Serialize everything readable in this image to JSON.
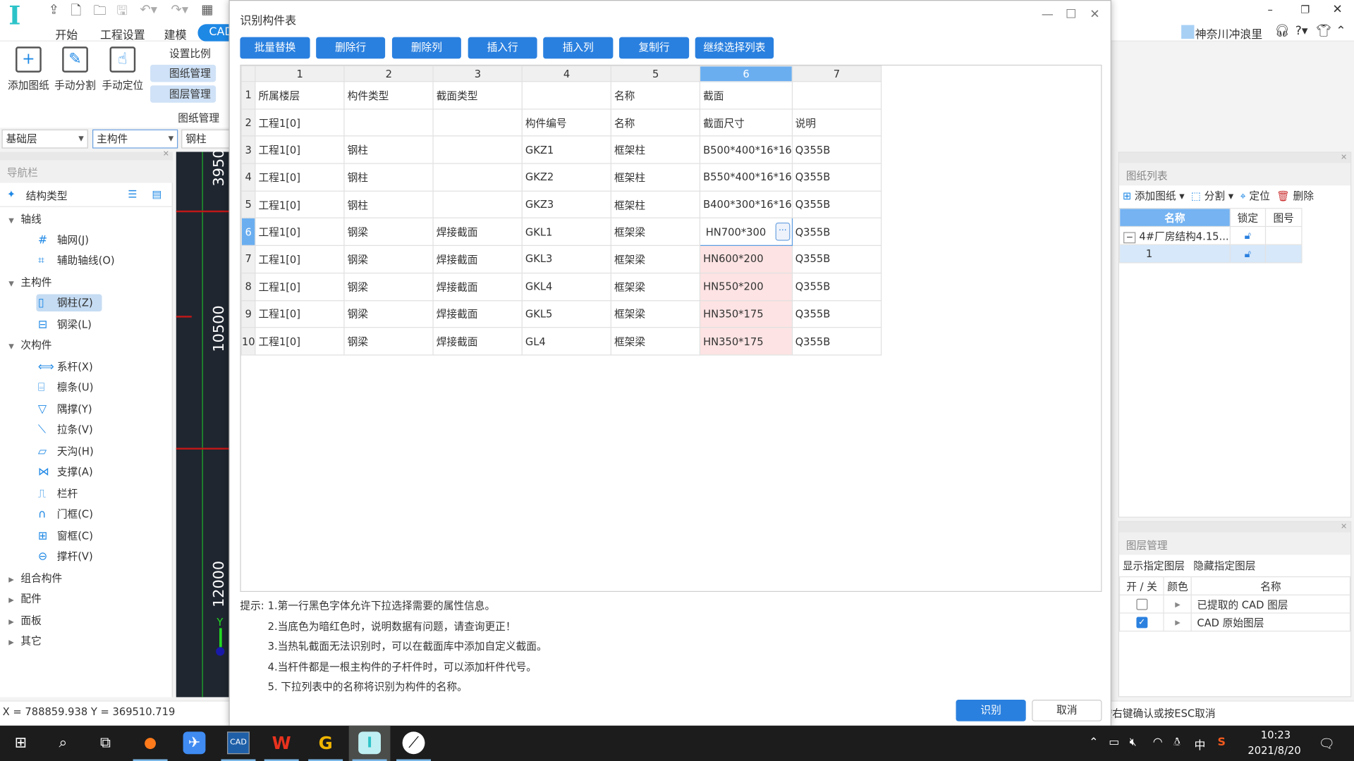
{
  "app": {
    "menu": [
      "开始",
      "工程设置",
      "建模",
      "CAD"
    ],
    "user": "神奈川冲浪里",
    "ribbon": {
      "big_buttons": [
        "添加图纸",
        "手动分割",
        "手动定位"
      ],
      "small_buttons": [
        "设置比例",
        "图纸管理",
        "图层管理"
      ],
      "group_label": "图纸管理"
    },
    "selectors": {
      "floor": "基础层",
      "category": "主构件",
      "type": "钢柱"
    }
  },
  "nav": {
    "title": "导航栏",
    "subtitle": "结构类型",
    "groups": [
      {
        "label": "轴线",
        "expanded": true,
        "items": [
          "轴网(J)",
          "辅助轴线(O)"
        ]
      },
      {
        "label": "主构件",
        "expanded": true,
        "items": [
          "钢柱(Z)",
          "钢梁(L)"
        ],
        "selected": "钢柱(Z)"
      },
      {
        "label": "次构件",
        "expanded": true,
        "items": [
          "系杆(X)",
          "檩条(U)",
          "隅撑(Y)",
          "拉条(V)",
          "天沟(H)",
          "支撑(A)",
          "栏杆",
          "门框(C)",
          "窗框(C)",
          "撑杆(V)"
        ]
      },
      {
        "label": "组合构件",
        "expanded": false
      },
      {
        "label": "配件",
        "expanded": false
      },
      {
        "label": "面板",
        "expanded": false
      },
      {
        "label": "其它",
        "expanded": false
      }
    ]
  },
  "canvas": {
    "dimensions": [
      "3950",
      "10500",
      "12000"
    ],
    "axis_label": "Y"
  },
  "status": {
    "coords": "X = 788859.938 Y = 369510.719",
    "prompt": "按右键确认或按ESC取消"
  },
  "dialog": {
    "title": "识别构件表",
    "toolbar": [
      "批量替换",
      "删除行",
      "删除列",
      "插入行",
      "插入列",
      "复制行",
      "继续选择列表"
    ],
    "columns": [
      "1",
      "2",
      "3",
      "4",
      "5",
      "6",
      "7"
    ],
    "selected_column": "6",
    "selected_row": "6",
    "rows": [
      [
        "所属楼层",
        "构件类型",
        "截面类型",
        "",
        "名称",
        "截面",
        ""
      ],
      [
        "工程1[0]",
        "",
        "",
        "构件编号",
        "名称",
        "截面尺寸",
        "说明"
      ],
      [
        "工程1[0]",
        "钢柱",
        "",
        "GKZ1",
        "框架柱",
        "B500*400*16*16",
        "Q355B"
      ],
      [
        "工程1[0]",
        "钢柱",
        "",
        "GKZ2",
        "框架柱",
        "B550*400*16*16",
        "Q355B"
      ],
      [
        "工程1[0]",
        "钢柱",
        "",
        "GKZ3",
        "框架柱",
        "B400*300*16*16",
        "Q355B"
      ],
      [
        "工程1[0]",
        "钢梁",
        "焊接截面",
        "GKL1",
        "框架梁",
        "HN700*300",
        "Q355B"
      ],
      [
        "工程1[0]",
        "钢梁",
        "焊接截面",
        "GKL3",
        "框架梁",
        "HN600*200",
        "Q355B"
      ],
      [
        "工程1[0]",
        "钢梁",
        "焊接截面",
        "GKL4",
        "框架梁",
        "HN550*200",
        "Q355B"
      ],
      [
        "工程1[0]",
        "钢梁",
        "焊接截面",
        "GKL5",
        "框架梁",
        "HN350*175",
        "Q355B"
      ],
      [
        "工程1[0]",
        "钢梁",
        "焊接截面",
        "GL4",
        "框架梁",
        "HN350*175",
        "Q355B"
      ]
    ],
    "error_cells": [
      "7-6",
      "8-6",
      "9-6",
      "10-6"
    ],
    "error_color": "#fde3e3",
    "hint_label": "提示:",
    "hints": [
      "1.第一行黑色字体允许下拉选择需要的属性信息。",
      "2.当底色为暗红色时，说明数据有问题，请查询更正！",
      "3.当热轧截面无法识别时，可以在截面库中添加自定义截面。",
      "4.当杆件都是一根主构件的子杆件时，可以添加杆件代号。",
      "5. 下拉列表中的名称将识别为构件的名称。"
    ],
    "ok_label": "识别",
    "cancel_label": "取消"
  },
  "drawing_list": {
    "title": "图纸列表",
    "toolbar": [
      "添加图纸",
      "分割",
      "定位",
      "删除"
    ],
    "headers": [
      "名称",
      "锁定",
      "图号"
    ],
    "rows": [
      {
        "name": "4#厂房结构4.15...",
        "number": ""
      },
      {
        "name": "1",
        "number": ""
      }
    ]
  },
  "layer_mgmt": {
    "title": "图层管理",
    "actions": [
      "显示指定图层",
      "隐藏指定图层"
    ],
    "headers": [
      "开 / 关",
      "颜色",
      "名称"
    ],
    "rows": [
      {
        "name": "已提取的 CAD 图层",
        "on": false
      },
      {
        "name": "CAD 原始图层",
        "on": true
      }
    ]
  },
  "taskbar": {
    "apps": [
      "firefox",
      "feishu",
      "cad-viewer",
      "wps",
      "g-app",
      "steel-structure-app",
      "other-app"
    ],
    "active": "steel-structure-app",
    "ime": "中",
    "time": "10:23",
    "date": "2021/8/20"
  },
  "accent": "#2a80df"
}
